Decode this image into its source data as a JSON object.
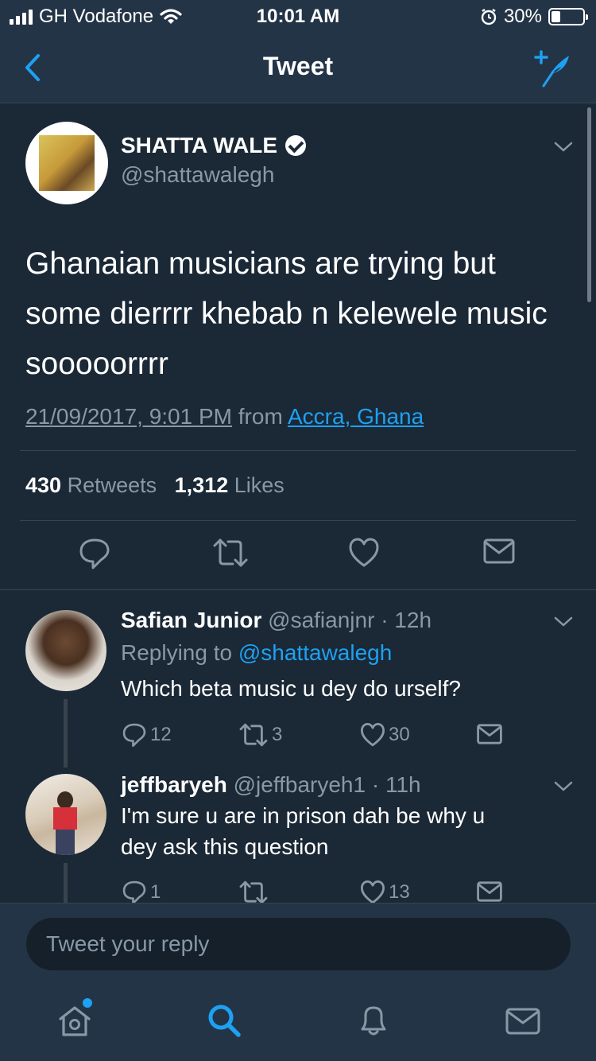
{
  "status_bar": {
    "carrier": "GH Vodafone",
    "time": "10:01 AM",
    "battery": "30%",
    "battery_level": 0.3
  },
  "nav": {
    "title": "Tweet"
  },
  "tweet": {
    "display_name": "SHATTA WALE",
    "handle": "@shattawalegh",
    "text": "Ghanaian musicians are trying but some dierrrr khebab n kelewele music sooooorrrr",
    "date": "21/09/2017, 9:01 PM",
    "from_label": "from",
    "location": "Accra, Ghana",
    "retweets_count": "430",
    "retweets_label": "Retweets",
    "likes_count": "1,312",
    "likes_label": "Likes"
  },
  "replies": [
    {
      "name": "Safian Junior",
      "handle": "@safianjnr",
      "time": "· 12h",
      "replying_prefix": "Replying to",
      "replying_to": "@shattawalegh",
      "text": "Which beta music u dey do urself?",
      "reply_count": "12",
      "retweet_count": "3",
      "like_count": "30"
    },
    {
      "name": "jeffbaryeh",
      "handle": "@jeffbaryeh1",
      "time": "· 11h",
      "text_line1": "I'm sure u are in prison dah be why u",
      "text_line2": "dey ask this question",
      "reply_count": "1",
      "retweet_count": "",
      "like_count": "13"
    }
  ],
  "reply_bar": {
    "placeholder": "Tweet your reply"
  },
  "colors": {
    "background": "#1b2836",
    "bars": "#243447",
    "accent": "#1da1f2",
    "secondary_text": "#8899a6",
    "divider": "#38444d"
  },
  "icons": {
    "tabs": [
      "home-icon",
      "search-icon",
      "notifications-icon",
      "messages-icon"
    ],
    "actions": [
      "reply-icon",
      "retweet-icon",
      "like-icon",
      "dm-icon"
    ]
  }
}
